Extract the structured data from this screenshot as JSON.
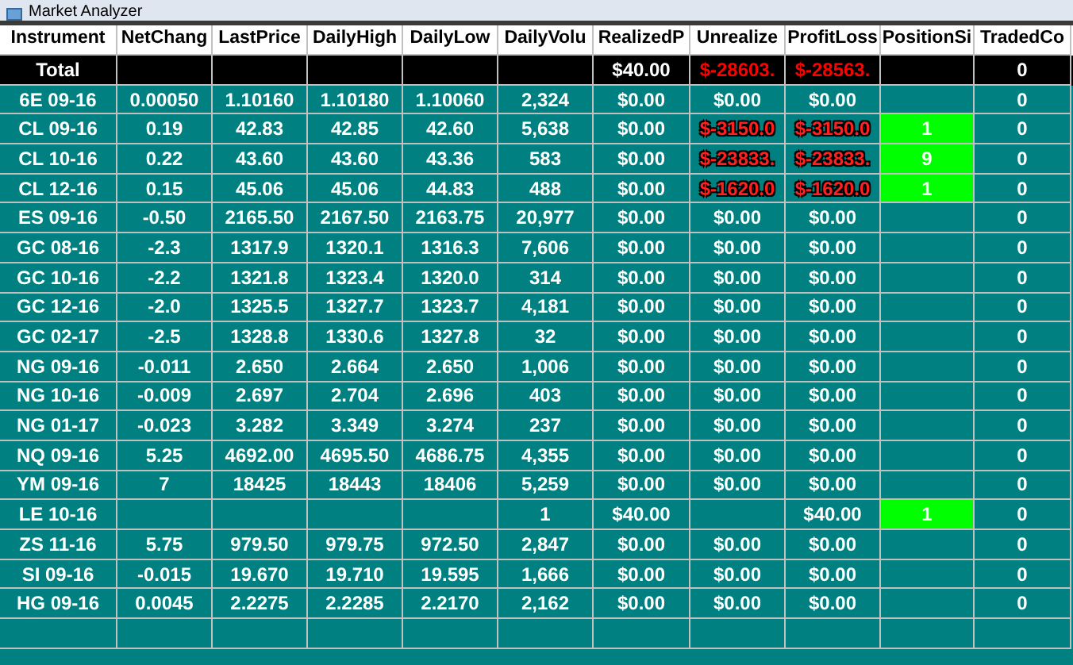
{
  "window": {
    "title": "Market Analyzer"
  },
  "columns": [
    "Instrument",
    "NetChang",
    "LastPrice",
    "DailyHigh",
    "DailyLow",
    "DailyVolu",
    "RealizedP",
    "Unrealize",
    "ProfitLoss",
    "PositionSi",
    "TradedCo"
  ],
  "rows": [
    {
      "kind": "total",
      "in_loss": true,
      "position_open": false,
      "cells": [
        "Total",
        null,
        null,
        null,
        null,
        null,
        "$40.00",
        "$-28603.",
        "$-28563.",
        null,
        "0"
      ]
    },
    {
      "kind": "instrument",
      "in_loss": false,
      "position_open": false,
      "cells": [
        "6E 09-16",
        "0.00050",
        "1.10160",
        "1.10180",
        "1.10060",
        "2,324",
        "$0.00",
        "$0.00",
        "$0.00",
        null,
        "0"
      ]
    },
    {
      "kind": "instrument",
      "in_loss": true,
      "position_open": true,
      "cells": [
        "CL 09-16",
        "0.19",
        "42.83",
        "42.85",
        "42.60",
        "5,638",
        "$0.00",
        "$-3150.0",
        "$-3150.0",
        "1",
        "0"
      ]
    },
    {
      "kind": "instrument",
      "in_loss": true,
      "position_open": true,
      "cells": [
        "CL 10-16",
        "0.22",
        "43.60",
        "43.60",
        "43.36",
        "583",
        "$0.00",
        "$-23833.",
        "$-23833.",
        "9",
        "0"
      ]
    },
    {
      "kind": "instrument",
      "in_loss": true,
      "position_open": true,
      "cells": [
        "CL 12-16",
        "0.15",
        "45.06",
        "45.06",
        "44.83",
        "488",
        "$0.00",
        "$-1620.0",
        "$-1620.0",
        "1",
        "0"
      ]
    },
    {
      "kind": "instrument",
      "in_loss": false,
      "position_open": false,
      "cells": [
        "ES 09-16",
        "-0.50",
        "2165.50",
        "2167.50",
        "2163.75",
        "20,977",
        "$0.00",
        "$0.00",
        "$0.00",
        null,
        "0"
      ]
    },
    {
      "kind": "instrument",
      "in_loss": false,
      "position_open": false,
      "cells": [
        "GC 08-16",
        "-2.3",
        "1317.9",
        "1320.1",
        "1316.3",
        "7,606",
        "$0.00",
        "$0.00",
        "$0.00",
        null,
        "0"
      ]
    },
    {
      "kind": "instrument",
      "in_loss": false,
      "position_open": false,
      "cells": [
        "GC 10-16",
        "-2.2",
        "1321.8",
        "1323.4",
        "1320.0",
        "314",
        "$0.00",
        "$0.00",
        "$0.00",
        null,
        "0"
      ]
    },
    {
      "kind": "instrument",
      "in_loss": false,
      "position_open": false,
      "cells": [
        "GC 12-16",
        "-2.0",
        "1325.5",
        "1327.7",
        "1323.7",
        "4,181",
        "$0.00",
        "$0.00",
        "$0.00",
        null,
        "0"
      ]
    },
    {
      "kind": "instrument",
      "in_loss": false,
      "position_open": false,
      "cells": [
        "GC 02-17",
        "-2.5",
        "1328.8",
        "1330.6",
        "1327.8",
        "32",
        "$0.00",
        "$0.00",
        "$0.00",
        null,
        "0"
      ]
    },
    {
      "kind": "instrument",
      "in_loss": false,
      "position_open": false,
      "cells": [
        "NG 09-16",
        "-0.011",
        "2.650",
        "2.664",
        "2.650",
        "1,006",
        "$0.00",
        "$0.00",
        "$0.00",
        null,
        "0"
      ]
    },
    {
      "kind": "instrument",
      "in_loss": false,
      "position_open": false,
      "cells": [
        "NG 10-16",
        "-0.009",
        "2.697",
        "2.704",
        "2.696",
        "403",
        "$0.00",
        "$0.00",
        "$0.00",
        null,
        "0"
      ]
    },
    {
      "kind": "instrument",
      "in_loss": false,
      "position_open": false,
      "cells": [
        "NG 01-17",
        "-0.023",
        "3.282",
        "3.349",
        "3.274",
        "237",
        "$0.00",
        "$0.00",
        "$0.00",
        null,
        "0"
      ]
    },
    {
      "kind": "instrument",
      "in_loss": false,
      "position_open": false,
      "cells": [
        "NQ 09-16",
        "5.25",
        "4692.00",
        "4695.50",
        "4686.75",
        "4,355",
        "$0.00",
        "$0.00",
        "$0.00",
        null,
        "0"
      ]
    },
    {
      "kind": "instrument",
      "in_loss": false,
      "position_open": false,
      "cells": [
        "YM 09-16",
        "7",
        "18425",
        "18443",
        "18406",
        "5,259",
        "$0.00",
        "$0.00",
        "$0.00",
        null,
        "0"
      ]
    },
    {
      "kind": "instrument",
      "in_loss": false,
      "position_open": true,
      "cells": [
        "LE 10-16",
        null,
        null,
        null,
        null,
        "1",
        "$40.00",
        null,
        "$40.00",
        "1",
        "0"
      ]
    },
    {
      "kind": "instrument",
      "in_loss": false,
      "position_open": false,
      "cells": [
        "ZS 11-16",
        "5.75",
        "979.50",
        "979.75",
        "972.50",
        "2,847",
        "$0.00",
        "$0.00",
        "$0.00",
        null,
        "0"
      ]
    },
    {
      "kind": "instrument",
      "in_loss": false,
      "position_open": false,
      "cells": [
        "SI 09-16",
        "-0.015",
        "19.670",
        "19.710",
        "19.595",
        "1,666",
        "$0.00",
        "$0.00",
        "$0.00",
        null,
        "0"
      ]
    },
    {
      "kind": "instrument",
      "in_loss": false,
      "position_open": false,
      "cells": [
        "HG 09-16",
        "0.0045",
        "2.2275",
        "2.2285",
        "2.2170",
        "2,162",
        "$0.00",
        "$0.00",
        "$0.00",
        null,
        "0"
      ]
    }
  ]
}
